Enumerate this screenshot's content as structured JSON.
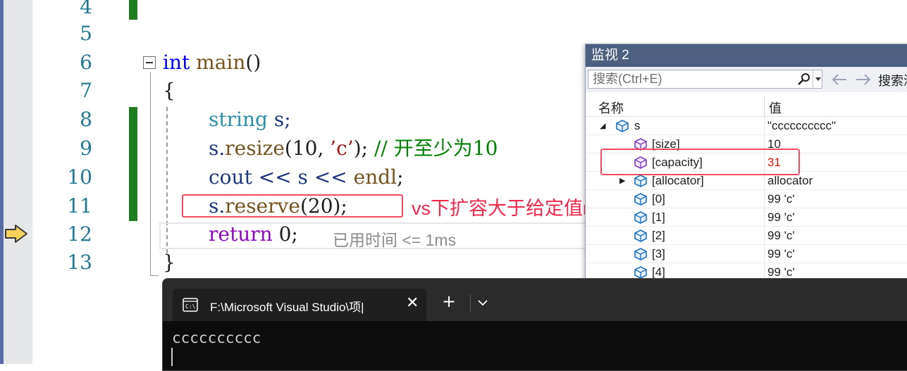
{
  "editor": {
    "line_numbers": [
      "4",
      "5",
      "6",
      "7",
      "8",
      "9",
      "10",
      "11",
      "12",
      "13"
    ],
    "code": {
      "l6_kw": "int",
      "l6_fn": "main",
      "l6_punct": "()",
      "l7": "{",
      "l8_type": "string",
      "l8_rest": " s;",
      "l9_obj": "s.",
      "l9_fn": "resize",
      "l9_args_a": "(10, ",
      "l9_char": "’c’",
      "l9_args_b": ");",
      "l9_comment": " // 开至少为10",
      "l10_id": "cout",
      "l10_op1": " << s << ",
      "l10_endl": "endl",
      "l10_end": ";",
      "l11_obj": "s.",
      "l11_fn": "reserve",
      "l11_args": "(20);",
      "l12_kw": "return",
      "l12_rest": " 0;",
      "l13": "}"
    },
    "elapsed_text": "已用时间 <= 1ms",
    "annotation": "vs下扩容大于给定值n",
    "current_line_arrow": "current-line-arrow-icon"
  },
  "watch": {
    "title": "监视 2",
    "search_placeholder": "搜索(Ctrl+E)",
    "search_depth_label": "搜索深",
    "header_name": "名称",
    "header_value": "值",
    "rows": [
      {
        "name": "s",
        "value": "\"cccccccccc\""
      },
      {
        "name": "[size]",
        "value": "10"
      },
      {
        "name": "[capacity]",
        "value": "31"
      },
      {
        "name": "[allocator]",
        "value": "allocator"
      },
      {
        "name": "[0]",
        "value": "99 'c'"
      },
      {
        "name": "[1]",
        "value": "99 'c'"
      },
      {
        "name": "[2]",
        "value": "99 'c'"
      },
      {
        "name": "[3]",
        "value": "99 'c'"
      },
      {
        "name": "[4]",
        "value": "99 'c'"
      }
    ]
  },
  "terminal": {
    "tab_title": "F:\\Microsoft Visual Studio\\项|",
    "close_glyph": "✕",
    "new_tab_glyph": "+",
    "output": "cccccccccc"
  },
  "colors": {
    "accent_red": "#f24961",
    "change_bar_green": "#1e7d1e",
    "watch_title_bg": "#4d6082",
    "terminal_bg": "#0c0c0c"
  }
}
